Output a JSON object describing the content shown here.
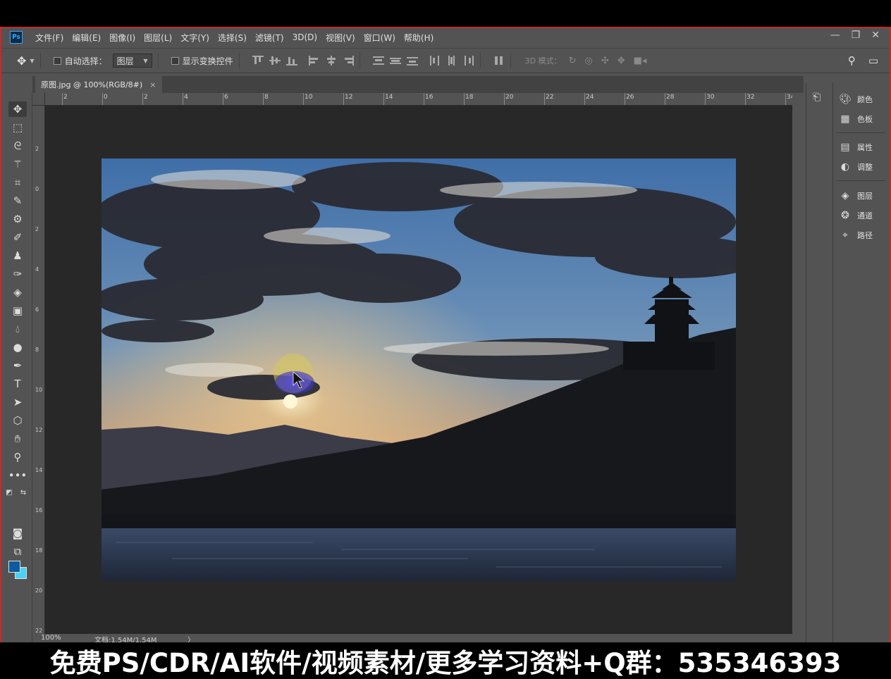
{
  "app": {
    "logo": "Ps"
  },
  "menu": [
    "文件(F)",
    "编辑(E)",
    "图像(I)",
    "图层(L)",
    "文字(Y)",
    "选择(S)",
    "滤镜(T)",
    "3D(D)",
    "视图(V)",
    "窗口(W)",
    "帮助(H)"
  ],
  "window_controls": {
    "minimize": "—",
    "restore": "❐",
    "close": "✕"
  },
  "options": {
    "auto_select_label": "自动选择：",
    "auto_select_value": "图层",
    "show_transform_label": "显示变换控件",
    "mode_3d_label": "3D 模式："
  },
  "document": {
    "tab_title": "原图.jpg @ 100%(RGB/8#)",
    "close": "×"
  },
  "ruler_top": [
    "2",
    "0",
    "2",
    "4",
    "6",
    "8",
    "10",
    "12",
    "14",
    "16",
    "18",
    "20",
    "22",
    "24",
    "26",
    "28",
    "30",
    "32",
    "34"
  ],
  "ruler_left": [
    "2",
    "0",
    "2",
    "4",
    "6",
    "8",
    "10",
    "12",
    "14",
    "16",
    "18",
    "20",
    "22"
  ],
  "status": {
    "zoom": "100%",
    "doc_size": "文档:1.54M/1.54M",
    "arrow": "〉"
  },
  "panels": [
    {
      "icon": "palette-icon",
      "label": "颜色"
    },
    {
      "icon": "grid-icon",
      "label": "色板"
    },
    {
      "icon": "properties-icon",
      "label": "属性"
    },
    {
      "icon": "adjust-icon",
      "label": "调整"
    },
    {
      "icon": "layers-icon",
      "label": "图层"
    },
    {
      "icon": "channels-icon",
      "label": "通道"
    },
    {
      "icon": "paths-icon",
      "label": "路径"
    }
  ],
  "banner": "免费PS/CDR/AI软件/视频素材/更多学习资料+Q群：535346393",
  "colors": {
    "foreground": "#0d5b9e",
    "background": "#4ad2f2",
    "accent": "#31a8ff"
  }
}
